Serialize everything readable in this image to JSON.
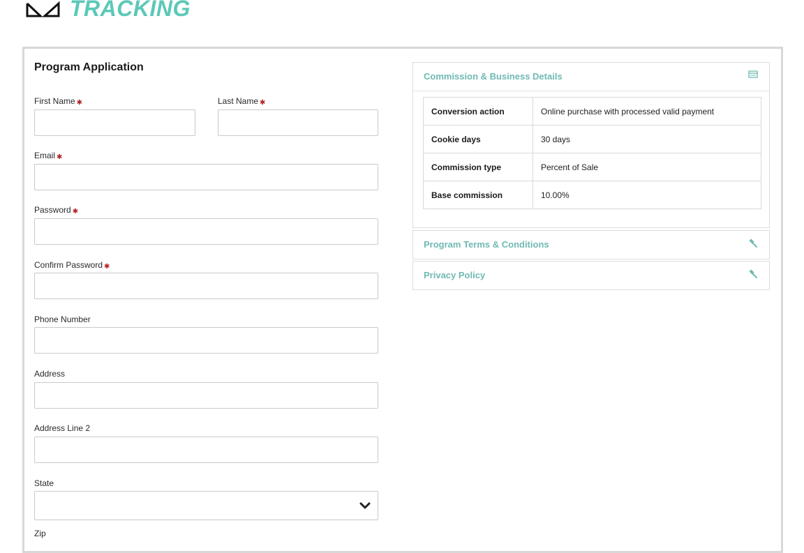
{
  "brand": {
    "logo_text": "TRACKING",
    "accent_color": "#5cc8b8"
  },
  "form": {
    "title": "Program Application",
    "required_marker": "✱",
    "fields": {
      "first_name": {
        "label": "First Name",
        "value": "",
        "required": true
      },
      "last_name": {
        "label": "Last Name",
        "value": "",
        "required": true
      },
      "email": {
        "label": "Email",
        "value": "",
        "required": true
      },
      "password": {
        "label": "Password",
        "value": "",
        "required": true
      },
      "confirm_password": {
        "label": "Confirm Password",
        "value": "",
        "required": true
      },
      "phone": {
        "label": "Phone Number",
        "value": "",
        "required": false
      },
      "address": {
        "label": "Address",
        "value": "",
        "required": false
      },
      "address2": {
        "label": "Address Line 2",
        "value": "",
        "required": false
      },
      "state": {
        "label": "State",
        "value": "",
        "required": false
      },
      "zip": {
        "label": "Zip",
        "required": false
      }
    }
  },
  "sidebar": {
    "commission_panel": {
      "title": "Commission & Business Details",
      "icon": "card-icon",
      "rows": [
        {
          "key": "Conversion action",
          "value": "Online purchase with processed valid payment"
        },
        {
          "key": "Cookie days",
          "value": "30 days"
        },
        {
          "key": "Commission type",
          "value": "Percent of Sale"
        },
        {
          "key": "Base commission",
          "value": "10.00%"
        }
      ]
    },
    "terms_panel": {
      "title": "Program Terms & Conditions",
      "icon": "gavel-icon"
    },
    "privacy_panel": {
      "title": "Privacy Policy",
      "icon": "gavel-icon"
    }
  },
  "colors": {
    "panel_title": "#6fb9b3",
    "required": "#b22222",
    "border": "#c9c9c9"
  }
}
